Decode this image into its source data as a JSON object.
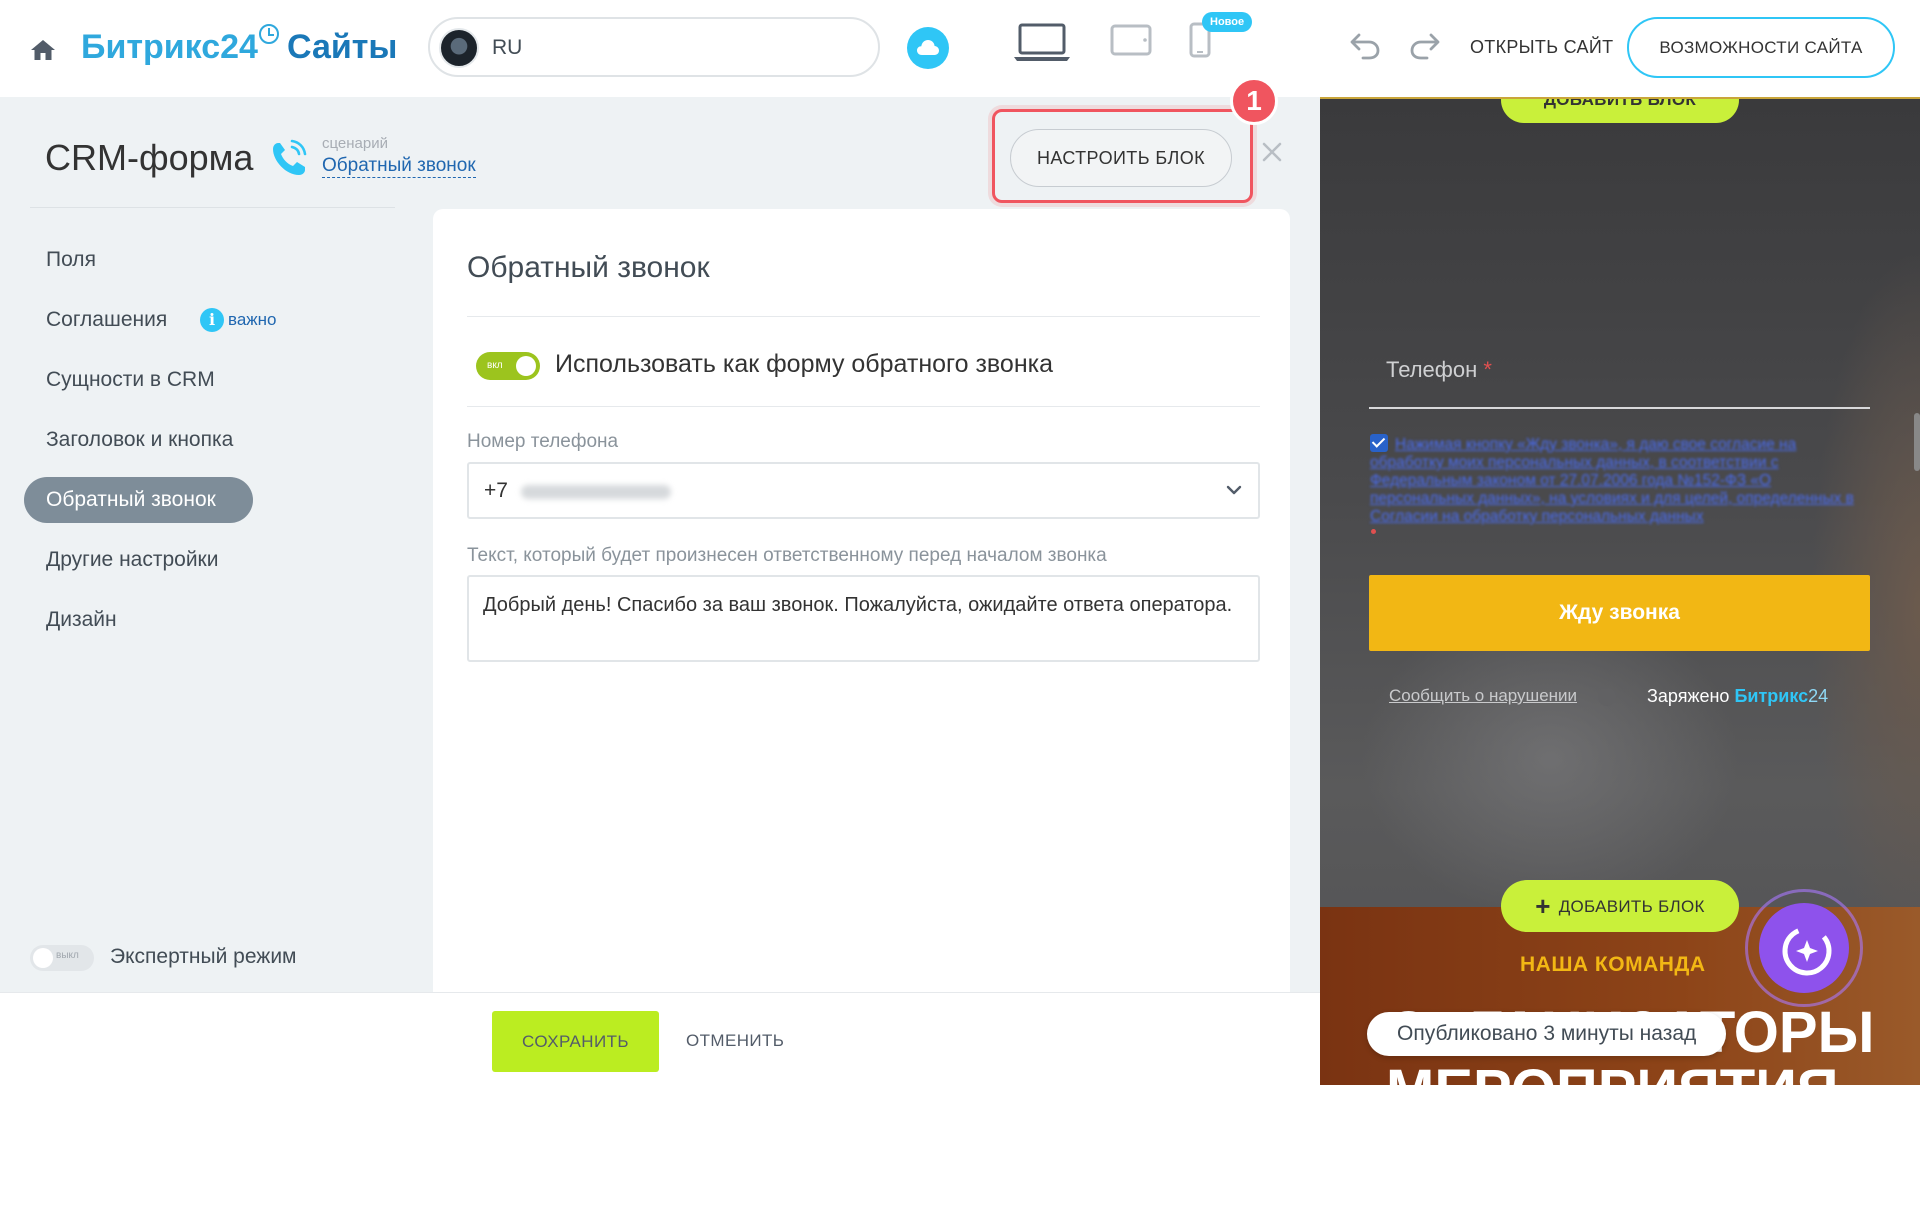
{
  "header": {
    "logo_brand": "Битрикс24",
    "logo_product": "Сайты",
    "site_lang": "RU",
    "new_badge": "Новое",
    "open_site": "ОТКРЫТЬ САЙТ",
    "site_features": "ВОЗМОЖНОСТИ САЙТА"
  },
  "panel": {
    "title": "CRM-форма",
    "scenario_label": "сценарий",
    "scenario_value": "Обратный звонок",
    "configure_button": "НАСТРОИТЬ БЛОК",
    "step_number": "1"
  },
  "menu": {
    "items": [
      "Поля",
      "Соглашения",
      "Сущности в CRM",
      "Заголовок и кнопка",
      "Обратный звонок",
      "Другие настройки",
      "Дизайн"
    ],
    "important_label": "важно",
    "active_index": 4
  },
  "expert": {
    "toggle_state": "выкл",
    "label": "Экспертный режим"
  },
  "card": {
    "title": "Обратный звонок",
    "toggle_state": "вкл",
    "toggle_label": "Использовать как форму обратного звонка",
    "phone_label": "Номер телефона",
    "phone_value": "+7",
    "text_label": "Текст, который будет произнесен ответственному перед началом звонка",
    "text_value": "Добрый день! Спасибо за ваш звонок. Пожалуйста, ожидайте ответа оператора."
  },
  "footer": {
    "save": "СОХРАНИТЬ",
    "cancel": "ОТМЕНИТЬ"
  },
  "preview": {
    "add_block": "ДОБАВИТЬ БЛОК",
    "phone_field": "Телефон",
    "required_mark": "*",
    "consent_text": "Нажимая кнопку «Жду звонка», я даю свое согласие на обработку моих персональных данных, в соответствии с Федеральным законом от 27.07.2006 года №152-ФЗ «О персональных данных», на условиях и для целей, определенных в Согласии на обработку персональных данных",
    "submit": "Жду звонка",
    "report": "Сообщить о нарушении",
    "powered_prefix": "Заряжено",
    "powered_brand": "Битрикс",
    "powered_num": "24",
    "team_label": "НАША КОМАНДА",
    "heading_line1": "ОРГАНИЗАТОРЫ",
    "heading_line2": "МЕРОПРИЯТИЯ",
    "published": "Опубликовано 3 минуты назад"
  },
  "colors": {
    "accent_blue": "#2fc6f6",
    "brand_blue": "#2fa8dd",
    "save_green": "#bbed21",
    "highlight_red": "#f0555f",
    "submit_yellow": "#f2b714"
  }
}
